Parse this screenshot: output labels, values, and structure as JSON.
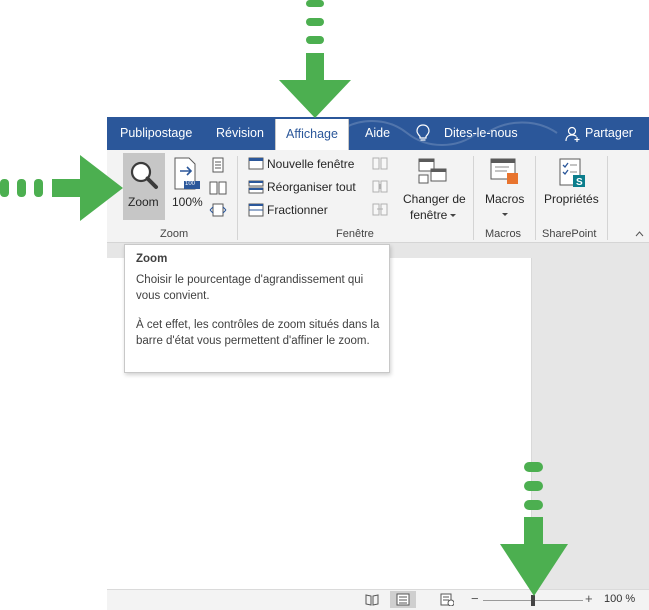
{
  "tabs": [
    {
      "label": "Publipostage",
      "active": false
    },
    {
      "label": "Révision",
      "active": false
    },
    {
      "label": "Affichage",
      "active": true
    },
    {
      "label": "Aide",
      "active": false
    },
    {
      "label": "Dites-le-nous",
      "active": false
    }
  ],
  "share_label": "Partager",
  "ribbon": {
    "zoom_group": {
      "label": "Zoom",
      "zoom_button": "Zoom",
      "hundred_button": "100%",
      "hundred_badge": "100"
    },
    "window_group": {
      "label": "Fenêtre",
      "new_window": "Nouvelle fenêtre",
      "arrange_all": "Réorganiser tout",
      "split": "Fractionner",
      "switch_windows_line1": "Changer de",
      "switch_windows_line2": "fenêtre"
    },
    "macros_group": {
      "label": "Macros",
      "button": "Macros"
    },
    "sharepoint_group": {
      "label": "SharePoint",
      "button": "Propriétés"
    }
  },
  "tooltip": {
    "title": "Zoom",
    "para1": "Choisir le pourcentage d'agrandissement qui vous convient.",
    "para2": "À cet effet, les contrôles de zoom situés dans la barre d'état vous permettent d'affiner le zoom."
  },
  "statusbar": {
    "zoom_minus": "−",
    "zoom_plus": "+",
    "zoom_percent": "100 %",
    "zoom_level_percent": 100
  },
  "colors": {
    "tab_bar": "#2b579a",
    "ribbon_bg": "#f3f3f3",
    "arrow_green": "#4caf50",
    "zoom_button_pressed": "#c6c6c6"
  }
}
